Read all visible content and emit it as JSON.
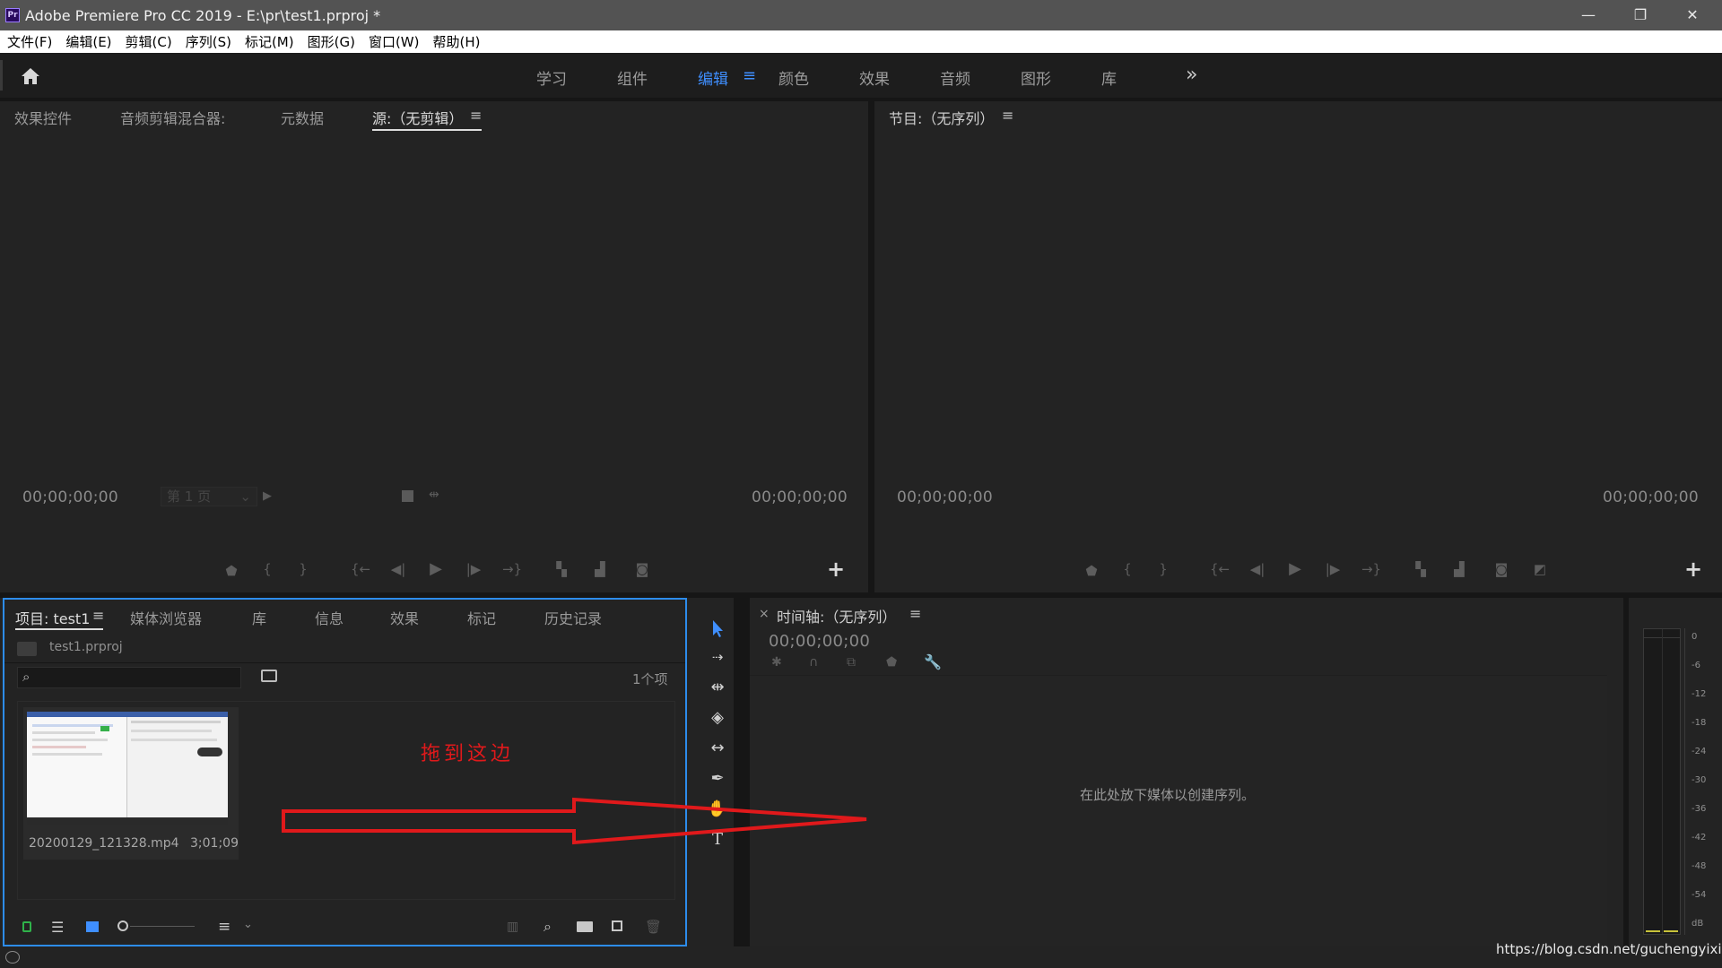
{
  "window": {
    "app_icon_text": "Pr",
    "title": "Adobe Premiere Pro CC 2019 - E:\\pr\\test1.prproj *",
    "minimize": "—",
    "restore": "❐",
    "close": "✕"
  },
  "menu": [
    "文件(F)",
    "编辑(E)",
    "剪辑(C)",
    "序列(S)",
    "标记(M)",
    "图形(G)",
    "窗口(W)",
    "帮助(H)"
  ],
  "workspaces": {
    "items": [
      "学习",
      "组件",
      "编辑",
      "颜色",
      "效果",
      "音频",
      "图形",
      "库"
    ],
    "active": "编辑",
    "menu_glyph": "≡",
    "more_glyph": "»"
  },
  "source_panel": {
    "tabs": [
      "效果控件",
      "音频剪辑混合器:",
      "元数据",
      "源:（无剪辑）"
    ],
    "active_tab": "源:（无剪辑）",
    "menu_glyph": "≡",
    "timecode_in": "00;00;00;00",
    "timecode_out": "00;00;00;00",
    "page_select": "第 1 页"
  },
  "program_panel": {
    "title": "节目:（无序列）",
    "menu_glyph": "≡",
    "timecode_in": "00;00;00;00",
    "timecode_out": "00;00;00;00"
  },
  "project_panel": {
    "tabs": [
      "项目: test1",
      "媒体浏览器",
      "库",
      "信息",
      "效果",
      "标记",
      "历史记录"
    ],
    "active_tab": "项目: test1",
    "menu_glyph": "≡",
    "project_file": "test1.prproj",
    "search_placeholder": "",
    "item_count": "1个项",
    "clip_name": "20200129_121328.mp4",
    "clip_duration": "3;01;09",
    "annotation": "拖到这边"
  },
  "timeline_panel": {
    "close_glyph": "×",
    "title": "时间轴:（无序列）",
    "menu_glyph": "≡",
    "timecode": "00;00;00;00",
    "drop_hint": "在此处放下媒体以创建序列。"
  },
  "audio_meter": {
    "ticks": [
      "0",
      "-6",
      "-12",
      "-18",
      "-24",
      "-30",
      "-36",
      "-42",
      "-48",
      "-54",
      "dB"
    ]
  },
  "watermark": "https://blog.csdn.net/guchengyixin",
  "colors": {
    "accent_blue": "#3f8fff",
    "panel_bg": "#232323",
    "annotation_red": "#e0191b",
    "project_focus_border": "#2d8ceb"
  }
}
